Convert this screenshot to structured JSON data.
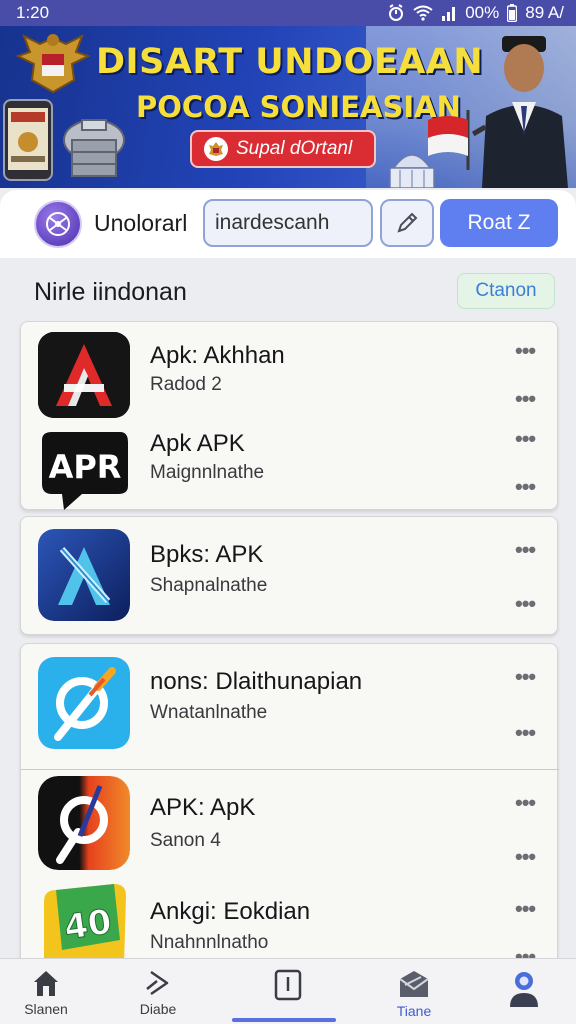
{
  "status": {
    "time": "1:20",
    "battery": "00%",
    "right_text": "89 A/"
  },
  "banner": {
    "title": "DISART UNDOEAAN",
    "subtitle": "POCOA SONIEASIAN",
    "button_label": "Supal dOrtanl"
  },
  "header": {
    "app_name": "Unolorarl",
    "search_value": "inardescanh",
    "action_label": "Roat Z"
  },
  "section": {
    "title": "Nirle iindonan",
    "button_label": "Ctanon"
  },
  "apps": [
    {
      "title": "Apk: Akhhan",
      "subtitle": "Radod 2"
    },
    {
      "title": "Apk APK",
      "subtitle": "Maignnlnathe",
      "icon_text": "APR"
    },
    {
      "title": "Bpks: APK",
      "subtitle": "Shapnalnathe"
    },
    {
      "title": "nons: Dlaithunapian",
      "subtitle": "Wnatanlnathe"
    },
    {
      "title": "APK: ApK",
      "subtitle": "Sanon 4"
    },
    {
      "title": "Ankgi: Eokdian",
      "subtitle": "Nnahnnlnatho",
      "icon_text": "40"
    }
  ],
  "nav": [
    {
      "label": "Slanen",
      "icon": "home-icon"
    },
    {
      "label": "Diabe",
      "icon": "play-icon"
    },
    {
      "label": "",
      "icon": "square-icon"
    },
    {
      "label": "Tiane",
      "icon": "mail-icon"
    },
    {
      "label": "",
      "icon": "profile-icon"
    }
  ],
  "colors": {
    "status_bar": "#4a4da8",
    "accent": "#5f7ff0",
    "banner_text": "#f6df3a",
    "banner_button": "#d92c33"
  }
}
